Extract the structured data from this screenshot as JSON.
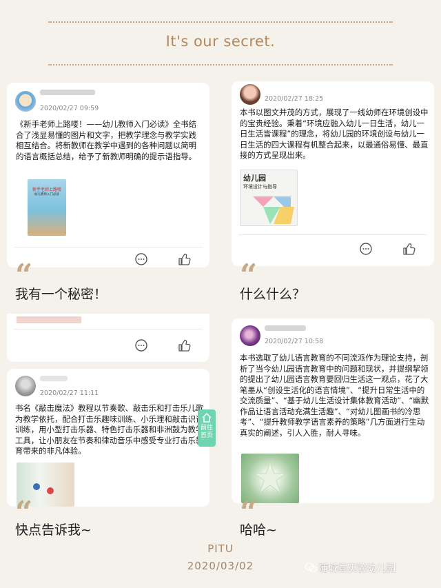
{
  "header": {
    "title": "It's our secret."
  },
  "cards": [
    {
      "date": "2020/02/27 09:59",
      "text": "《新手老师上路喽！——幼儿教师入门必读》全书结合了浅显易懂的图片和文字，把教学理念与教学实践相互结合。将新教师在教学中遇到的各种问题以简明的语言概括总结，给予了新教师明确的提示语指导。",
      "book_title": "新手老师上路喽",
      "book_subtitle": "幼儿教师入门必读"
    },
    {
      "date": "2020/02/27 18:25",
      "text": "本书以图文并茂的方式，展现了一线幼师在环境创设中的宝贵经验。秉着“环境应融入幼儿一日生活，幼儿一日生活皆课程”的理念，将幼儿园的环境创设与幼儿一日生活的四大课程有机整合起来，以最通俗易懂、最直接的方式呈现出来。",
      "book_title": "幼儿园",
      "book_subtitle": "环境设计与指导"
    },
    {
      "date": "2020/02/27 10:58",
      "text": "本书选取了幼儿语言教育的不同流派作为理论支持，剖析了当今幼儿园语言教育中的问题和现状，并提纲挈领的提出了幼儿园语言教育要回归生活这一观点，花了大笔墨从“创设生活化的语言情境”、“提升日常生活中的交流质量”、“基于幼儿生活设计集体教育活动”、“幽默作品让语言活动充满生活趣”、“对幼儿图画书的冷思考”、“提升教师教学语言素养的策略”几方面进行生动真实的阐述，引人入胜，耐人寻味。"
    },
    {
      "date": "2020/02/27 11:11",
      "text": "书名《敲击魔法》教程以节奏歌、敲击乐和打击乐儿歌为教学依托，配合打击乐趣味训练、小乐理和敲击识谱训练，用小型打击乐器、特色打击乐器和非洲鼓为教学工具，让小朋友在节奏和律动音乐中感受专业打击乐教育带来的非凡体验。"
    }
  ],
  "captions": [
    "我有一个秘密！",
    "什么什么？",
    "快点告诉我~",
    "哈哈~"
  ],
  "float_button": {
    "line1": "前往",
    "line2": "首页"
  },
  "footer": {
    "app": "PITU",
    "date": "2020/03/02"
  },
  "watermark": "浦城县实验幼儿园",
  "colors": {
    "accent": "#c9a27a",
    "background": "#f5f1eb",
    "float": "#6fd4b0"
  },
  "icons": [
    "comment-icon",
    "like-icon",
    "home-icon",
    "quote-icon",
    "wechat-icon"
  ]
}
